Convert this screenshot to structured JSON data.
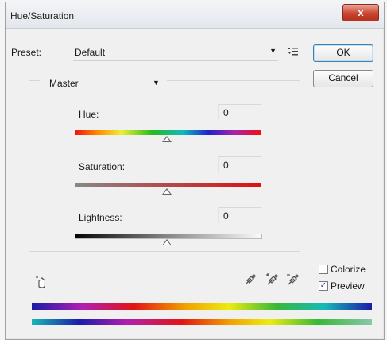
{
  "window": {
    "title": "Hue/Saturation",
    "close_label": "x"
  },
  "preset": {
    "label": "Preset:",
    "value": "Default"
  },
  "buttons": {
    "ok": "OK",
    "cancel": "Cancel"
  },
  "channel": {
    "value": "Master"
  },
  "sliders": [
    {
      "label": "Hue:",
      "value": "0"
    },
    {
      "label": "Saturation:",
      "value": "0"
    },
    {
      "label": "Lightness:",
      "value": "0"
    }
  ],
  "options": {
    "colorize": {
      "label": "Colorize",
      "checked": false
    },
    "preview": {
      "label": "Preview",
      "checked": true,
      "mark": "✓"
    }
  },
  "icons": [
    "close-icon",
    "preset-menu-icon",
    "dropdown-arrow-icon",
    "targeted-adjustment-hand-icon",
    "eyedropper-icon",
    "eyedropper-plus-icon",
    "eyedropper-minus-icon"
  ]
}
